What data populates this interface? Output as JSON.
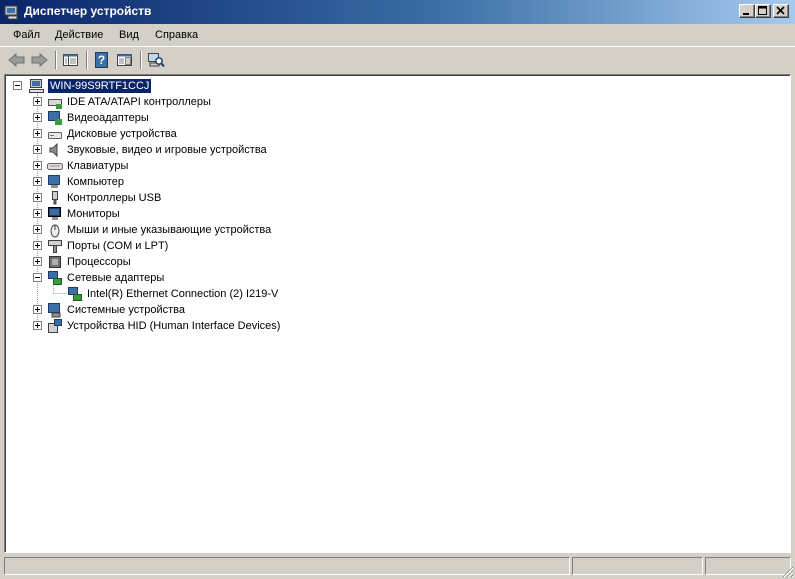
{
  "window": {
    "title": "Диспетчер устройств"
  },
  "menu": {
    "items": [
      "Файл",
      "Действие",
      "Вид",
      "Справка"
    ]
  },
  "toolbar": {
    "buttons": [
      "back-arrow-icon",
      "forward-arrow-icon",
      "show-hide-tree-icon",
      "help-icon",
      "properties-icon",
      "scan-hardware-icon"
    ]
  },
  "tree": {
    "root": {
      "label": "WIN-99S9RTF1CCJ",
      "expanded": true,
      "selected": true
    },
    "categories": [
      {
        "label": "IDE ATA/ATAPI контроллеры",
        "icon": "ide-controller-icon",
        "expanded": false
      },
      {
        "label": "Видеоадаптеры",
        "icon": "display-adapter-icon",
        "expanded": false
      },
      {
        "label": "Дисковые устройства",
        "icon": "disk-drive-icon",
        "expanded": false
      },
      {
        "label": "Звуковые, видео и игровые устройства",
        "icon": "speaker-icon",
        "expanded": false
      },
      {
        "label": "Клавиатуры",
        "icon": "keyboard-icon",
        "expanded": false
      },
      {
        "label": "Компьютер",
        "icon": "computer-icon",
        "expanded": false
      },
      {
        "label": "Контроллеры USB",
        "icon": "usb-icon",
        "expanded": false
      },
      {
        "label": "Мониторы",
        "icon": "monitor-icon",
        "expanded": false
      },
      {
        "label": "Мыши и иные указывающие устройства",
        "icon": "mouse-icon",
        "expanded": false
      },
      {
        "label": "Порты (COM и LPT)",
        "icon": "port-icon",
        "expanded": false
      },
      {
        "label": "Процессоры",
        "icon": "processor-icon",
        "expanded": false
      },
      {
        "label": "Сетевые адаптеры",
        "icon": "network-adapter-icon",
        "expanded": true,
        "children": [
          {
            "label": "Intel(R) Ethernet Connection (2) I219-V",
            "icon": "network-adapter-icon"
          }
        ]
      },
      {
        "label": "Системные устройства",
        "icon": "system-device-icon",
        "expanded": false
      },
      {
        "label": "Устройства HID (Human Interface Devices)",
        "icon": "hid-icon",
        "expanded": false
      }
    ]
  },
  "statusbar": {
    "panels": [
      "",
      "",
      ""
    ]
  },
  "colors": {
    "titlebar_start": "#0a246a",
    "titlebar_end": "#a6caf0",
    "selection": "#0a246a",
    "face": "#d4d0c8"
  }
}
